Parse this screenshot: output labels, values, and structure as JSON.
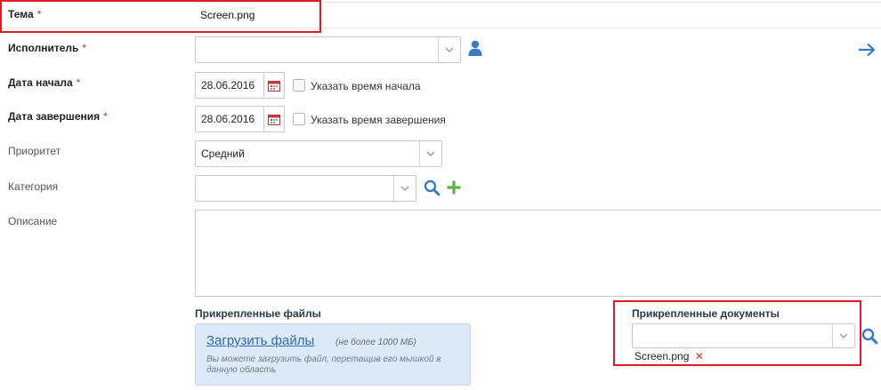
{
  "form": {
    "subject": {
      "label": "Тема",
      "required_mark": "*",
      "value": "Screen.png"
    },
    "assignee": {
      "label": "Исполнитель",
      "required_mark": "*",
      "value": ""
    },
    "start_date": {
      "label": "Дата начала",
      "required_mark": "*",
      "value": "28.06.2016",
      "checkbox_label": "Указать время начала"
    },
    "end_date": {
      "label": "Дата завершения",
      "required_mark": "*",
      "value": "28.06.2016",
      "checkbox_label": "Указать время завершения"
    },
    "priority": {
      "label": "Приоритет",
      "value": "Средний"
    },
    "category": {
      "label": "Категория",
      "value": ""
    },
    "description": {
      "label": "Описание",
      "value": ""
    }
  },
  "attachments": {
    "files_title": "Прикрепленные файлы",
    "upload_link": "Загрузить файлы",
    "upload_limit": "(не более 1000 МБ)",
    "upload_hint": "Вы можете загрузить файл, перетащив его мышкой в данную область"
  },
  "documents": {
    "title": "Прикрепленные документы",
    "value": "",
    "items": [
      {
        "name": "Screen.png"
      }
    ]
  },
  "icons": {
    "user": "user-icon",
    "arrow": "arrow-right-icon",
    "calendar": "calendar-icon",
    "search": "search-icon",
    "plus": "plus-icon",
    "chevron": "chevron-down-icon",
    "remove": "remove-icon"
  },
  "colors": {
    "highlight_frame": "#e01b24",
    "accent_blue": "#3a7bbf",
    "plus_green": "#5fb342",
    "required_star": "#d9262f"
  }
}
